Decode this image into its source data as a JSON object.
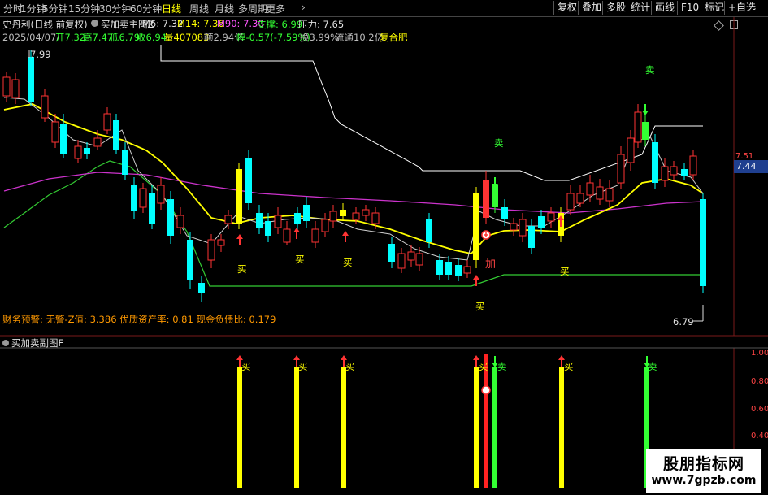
{
  "toolbar": {
    "periods": [
      "分时",
      "1分钟",
      "5分钟",
      "15分钟",
      "30分钟",
      "60分钟",
      "日线",
      "周线",
      "月线",
      "多周期",
      "更多"
    ],
    "active": "日线",
    "right_buttons": [
      "复权",
      "叠加",
      "多股",
      "统计",
      "画线",
      "F10",
      "标记",
      "+自选"
    ]
  },
  "header": {
    "stock_label": "史丹利(日线 前复权)",
    "indicator_name": "买加卖主图Z",
    "m6_label": "M6: 7.32",
    "m14_label": "M14: 7.36",
    "m90_label": "M90: 7.30",
    "support_label": "支撑: 6.99",
    "pressure_label": "压力: 7.65"
  },
  "quote": {
    "date": "2025/04/07/一",
    "open": "开7.32",
    "high": "高7.47",
    "low": "低6.79",
    "close": "收6.94",
    "volume": "量407083",
    "amount": "额2.94亿",
    "change": "幅-0.57(-7.59%)",
    "turnover": "换3.99%",
    "float_cap": "流通10.2亿",
    "sector": "复合肥"
  },
  "main_chart": {
    "high_marker": "7.99",
    "low_marker": "6.79",
    "price_axis_label": "7.51",
    "current_price": "7.44",
    "finance_warning": "财务预警: 无警-Z值: 3.386 优质资产率: 0.81 现金负债比: 0.179",
    "signal_buy": "买",
    "signal_sell": "卖",
    "signal_add": "加"
  },
  "sub_chart": {
    "title": "买加卖副图F",
    "axis_labels": [
      "1.00",
      "0.80",
      "0.60",
      "0.40"
    ],
    "signal_buy": "买",
    "signal_sell": "卖"
  },
  "watermark": {
    "line1": "股朋指标网",
    "line2": "www.7gpzb.com"
  },
  "colors": {
    "up_candle": "#ff3333",
    "down_candle": "#00ffff",
    "ma_yellow": "#ffff00",
    "ma_magenta": "#cc33cc",
    "support_green": "#33cc33",
    "pressure_white": "#ffffff"
  }
}
